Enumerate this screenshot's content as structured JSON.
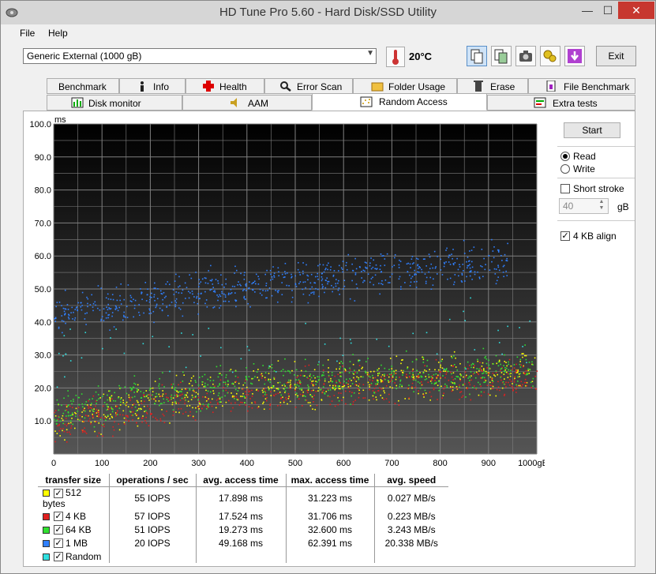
{
  "window": {
    "title": "HD Tune Pro 5.60 - Hard Disk/SSD Utility",
    "min_symbol": "—",
    "max_symbol": "☐",
    "close_symbol": "✕"
  },
  "menu": {
    "file": "File",
    "help": "Help"
  },
  "toolbar": {
    "drive": "Generic External (1000 gB)",
    "temperature": "20°C",
    "exit_label": "Exit",
    "icons": [
      "copy-text-icon",
      "copy-screenshot-icon",
      "camera-icon",
      "options-icon",
      "save-icon"
    ]
  },
  "tabs_row1": [
    {
      "label": "Benchmark",
      "icon": ""
    },
    {
      "label": "Info",
      "icon": "info-icon"
    },
    {
      "label": "Health",
      "icon": "health-cross-icon"
    },
    {
      "label": "Error Scan",
      "icon": "magnifier-icon"
    },
    {
      "label": "Folder Usage",
      "icon": "folder-icon"
    },
    {
      "label": "Erase",
      "icon": "trash-icon"
    },
    {
      "label": "File Benchmark",
      "icon": "file-benchmark-icon"
    }
  ],
  "tabs_row2": [
    {
      "label": "Disk monitor",
      "icon": "disk-monitor-icon"
    },
    {
      "label": "AAM",
      "icon": "speaker-icon"
    },
    {
      "label": "Random Access",
      "icon": "random-access-icon",
      "active": true
    },
    {
      "label": "Extra tests",
      "icon": "extra-tests-icon"
    }
  ],
  "panel": {
    "start_label": "Start",
    "read_label": "Read",
    "write_label": "Write",
    "mode": "read",
    "short_stroke_label": "Short stroke",
    "short_stroke_checked": false,
    "short_stroke_value": "40",
    "short_stroke_unit": "gB",
    "align_label": "4 KB align",
    "align_checked": true
  },
  "chart_data": {
    "type": "scatter",
    "ylabel": "ms",
    "xunit": "gB",
    "xlim": [
      0,
      1000
    ],
    "ylim": [
      0,
      100
    ],
    "yticks": [
      "100.0",
      "90.0",
      "80.0",
      "70.0",
      "60.0",
      "50.0",
      "40.0",
      "30.0",
      "20.0",
      "10.0"
    ],
    "xticks": [
      "0",
      "100",
      "200",
      "300",
      "400",
      "500",
      "600",
      "700",
      "800",
      "900",
      "1000gB"
    ],
    "grid": true,
    "series": [
      {
        "name": "512 bytes",
        "color": "#ffff00",
        "trend": [
          [
            0,
            10
          ],
          [
            200,
            16
          ],
          [
            400,
            20
          ],
          [
            600,
            22
          ],
          [
            800,
            24
          ],
          [
            1000,
            25
          ]
        ]
      },
      {
        "name": "4 KB",
        "color": "#e02020",
        "trend": [
          [
            0,
            9
          ],
          [
            200,
            14
          ],
          [
            400,
            18
          ],
          [
            600,
            20
          ],
          [
            800,
            22
          ],
          [
            1000,
            23
          ]
        ]
      },
      {
        "name": "64 KB",
        "color": "#30e030",
        "trend": [
          [
            0,
            13
          ],
          [
            200,
            18
          ],
          [
            400,
            21
          ],
          [
            600,
            23
          ],
          [
            800,
            25
          ],
          [
            1000,
            26
          ]
        ]
      },
      {
        "name": "1 MB",
        "color": "#3080ff",
        "trend": [
          [
            0,
            42
          ],
          [
            200,
            47
          ],
          [
            400,
            51
          ],
          [
            600,
            54
          ],
          [
            800,
            57
          ],
          [
            1000,
            59
          ]
        ]
      },
      {
        "name": "Random",
        "color": "#30e0e0",
        "trend": [
          [
            0,
            30
          ],
          [
            200,
            32
          ],
          [
            400,
            33
          ],
          [
            600,
            34
          ],
          [
            800,
            35
          ],
          [
            1000,
            36
          ]
        ]
      }
    ]
  },
  "stats": {
    "headers": [
      "transfer size",
      "operations / sec",
      "avg. access time",
      "max. access time",
      "avg. speed"
    ],
    "rows": [
      {
        "name": "512 bytes",
        "color": "#ffff00",
        "checked": true,
        "ops": "55 IOPS",
        "avg": "17.898 ms",
        "max": "31.223 ms",
        "speed": "0.027 MB/s"
      },
      {
        "name": "4 KB",
        "color": "#e02020",
        "checked": true,
        "ops": "57 IOPS",
        "avg": "17.524 ms",
        "max": "31.706 ms",
        "speed": "0.223 MB/s"
      },
      {
        "name": "64 KB",
        "color": "#30e030",
        "checked": true,
        "ops": "51 IOPS",
        "avg": "19.273 ms",
        "max": "32.600 ms",
        "speed": "3.243 MB/s"
      },
      {
        "name": "1 MB",
        "color": "#3080ff",
        "checked": true,
        "ops": "20 IOPS",
        "avg": "49.168 ms",
        "max": "62.391 ms",
        "speed": "20.338 MB/s"
      },
      {
        "name": "Random",
        "color": "#30e0e0",
        "checked": true,
        "ops": "",
        "avg": "",
        "max": "",
        "speed": ""
      }
    ]
  }
}
